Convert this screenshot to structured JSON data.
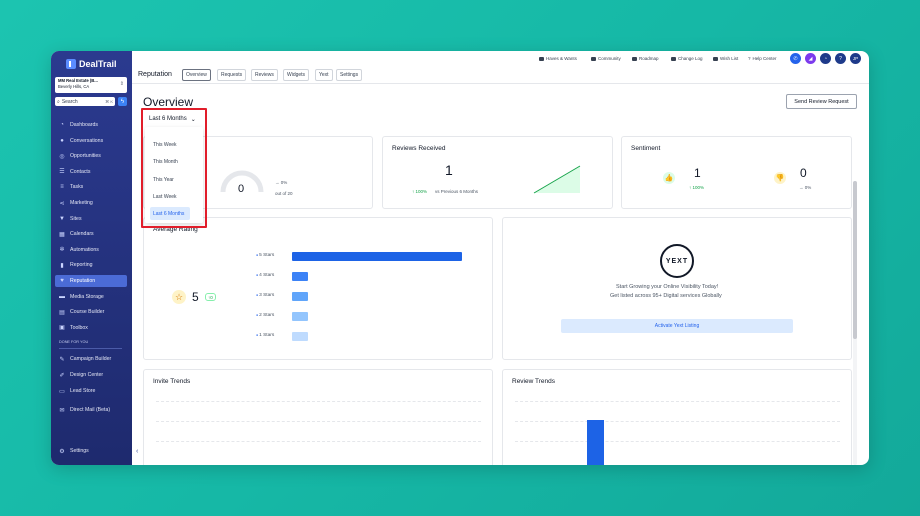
{
  "brand": {
    "name": "DealTrail"
  },
  "location": {
    "name": "MM Real Estate (B...",
    "city": "Beverly Hills, CA"
  },
  "search": {
    "placeholder": "Search",
    "shortcut": "⌘ K"
  },
  "nav": [
    {
      "label": "Dashboards",
      "icon": "dashboard-icon"
    },
    {
      "label": "Conversations",
      "icon": "chat-icon"
    },
    {
      "label": "Opportunities",
      "icon": "target-icon"
    },
    {
      "label": "Contacts",
      "icon": "contacts-icon"
    },
    {
      "label": "Tasks",
      "icon": "tasks-icon"
    },
    {
      "label": "Marketing",
      "icon": "share-icon"
    },
    {
      "label": "Sites",
      "icon": "filter-icon"
    },
    {
      "label": "Calendars",
      "icon": "calendar-icon"
    },
    {
      "label": "Automations",
      "icon": "automation-icon"
    },
    {
      "label": "Reporting",
      "icon": "chart-icon"
    },
    {
      "label": "Reputation",
      "icon": "heart-icon",
      "active": true
    },
    {
      "label": "Media Storage",
      "icon": "folder-icon"
    },
    {
      "label": "Course Builder",
      "icon": "course-icon"
    },
    {
      "label": "Toolbox",
      "icon": "toolbox-icon"
    }
  ],
  "done_for_you": {
    "label": "DONE FOR YOU",
    "items": [
      {
        "label": "Campaign Builder",
        "icon": "campaign-icon"
      },
      {
        "label": "Design Center",
        "icon": "design-icon"
      },
      {
        "label": "Lead Store",
        "icon": "store-icon"
      },
      {
        "label": "Direct Mail (Beta)",
        "icon": "mail-icon"
      }
    ]
  },
  "settings_label": "Settings",
  "topbar": {
    "links": [
      "Haves & Wants",
      "Community",
      "Roadmap",
      "Change Log",
      "Wish List",
      "Help Center"
    ],
    "avatar_initials": "JP"
  },
  "tabs": {
    "title": "Reputation",
    "items": [
      "Overview",
      "Requests",
      "Reviews",
      "Widgets",
      "Yext",
      "Settings"
    ],
    "selected": "Overview"
  },
  "page": {
    "title": "Overview",
    "send_button": "Send Review Request",
    "period_value": "Last 6 Months",
    "period_options": [
      "This Week",
      "This Month",
      "This Year",
      "Last Week",
      "Last 6 Months"
    ]
  },
  "cards": {
    "requests": {
      "value": "0",
      "change": "0%",
      "out_of": "out of 20"
    },
    "reviews_received": {
      "title": "Reviews Received",
      "value": "1",
      "change": "100%",
      "compare": "vs Previous 6 Months"
    },
    "sentiment": {
      "title": "Sentiment",
      "positive": "1",
      "positive_change": "100%",
      "negative": "0",
      "negative_change": "0%"
    },
    "average_rating": {
      "title": "Average Rating",
      "value": "5",
      "badge": "0",
      "rows": [
        {
          "label": "5 Stars",
          "fraction": 1.0
        },
        {
          "label": "4 Stars",
          "fraction": 0.0
        },
        {
          "label": "3 Stars",
          "fraction": 0.0
        },
        {
          "label": "2 Stars",
          "fraction": 0.0
        },
        {
          "label": "1 Stars",
          "fraction": 0.0
        }
      ]
    },
    "yext": {
      "logo_text": "YEXT",
      "line1": "Start Growing your Online Visibility Today!",
      "line2": "Get listed across 95+ Digital services Globally",
      "button": "Activate Yext Listing"
    },
    "invite_trends": {
      "title": "Invite Trends"
    },
    "review_trends": {
      "title": "Review Trends"
    }
  },
  "colors": {
    "sidebar": "#2b3a8f",
    "accent": "#2563eb",
    "highlight_box": "#e11d2a",
    "positive": "#16a34a",
    "background": "#16b8a6"
  }
}
